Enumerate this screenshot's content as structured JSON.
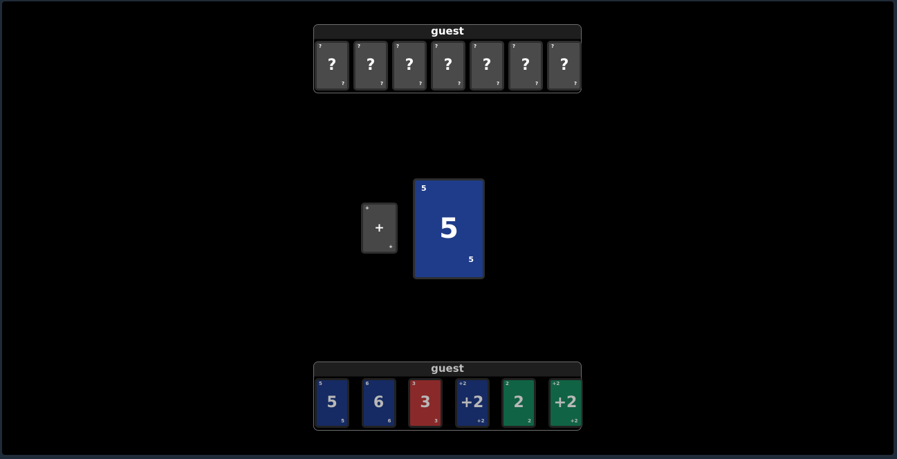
{
  "colors": {
    "blue": "#1f3c8a",
    "red": "#c0393a",
    "green": "#178a5f",
    "back": "#4a4a4a"
  },
  "opponent": {
    "name": "guest",
    "cards": [
      {
        "symbol": "?",
        "corner": "?"
      },
      {
        "symbol": "?",
        "corner": "?"
      },
      {
        "symbol": "?",
        "corner": "?"
      },
      {
        "symbol": "?",
        "corner": "?"
      },
      {
        "symbol": "?",
        "corner": "?"
      },
      {
        "symbol": "?",
        "corner": "?"
      },
      {
        "symbol": "?",
        "corner": "?"
      }
    ]
  },
  "deck": {
    "symbol": "+",
    "corner": "+"
  },
  "discard": {
    "value": "5",
    "corner": "5",
    "color": "blue"
  },
  "player": {
    "name": "guest",
    "cards": [
      {
        "value": "5",
        "corner": "5",
        "color": "blue"
      },
      {
        "value": "6",
        "corner": "6",
        "color": "blue"
      },
      {
        "value": "3",
        "corner": "3",
        "color": "red"
      },
      {
        "value": "+2",
        "corner": "+2",
        "color": "blue"
      },
      {
        "value": "2",
        "corner": "2",
        "color": "green"
      },
      {
        "value": "+2",
        "corner": "+2",
        "color": "green"
      }
    ]
  }
}
